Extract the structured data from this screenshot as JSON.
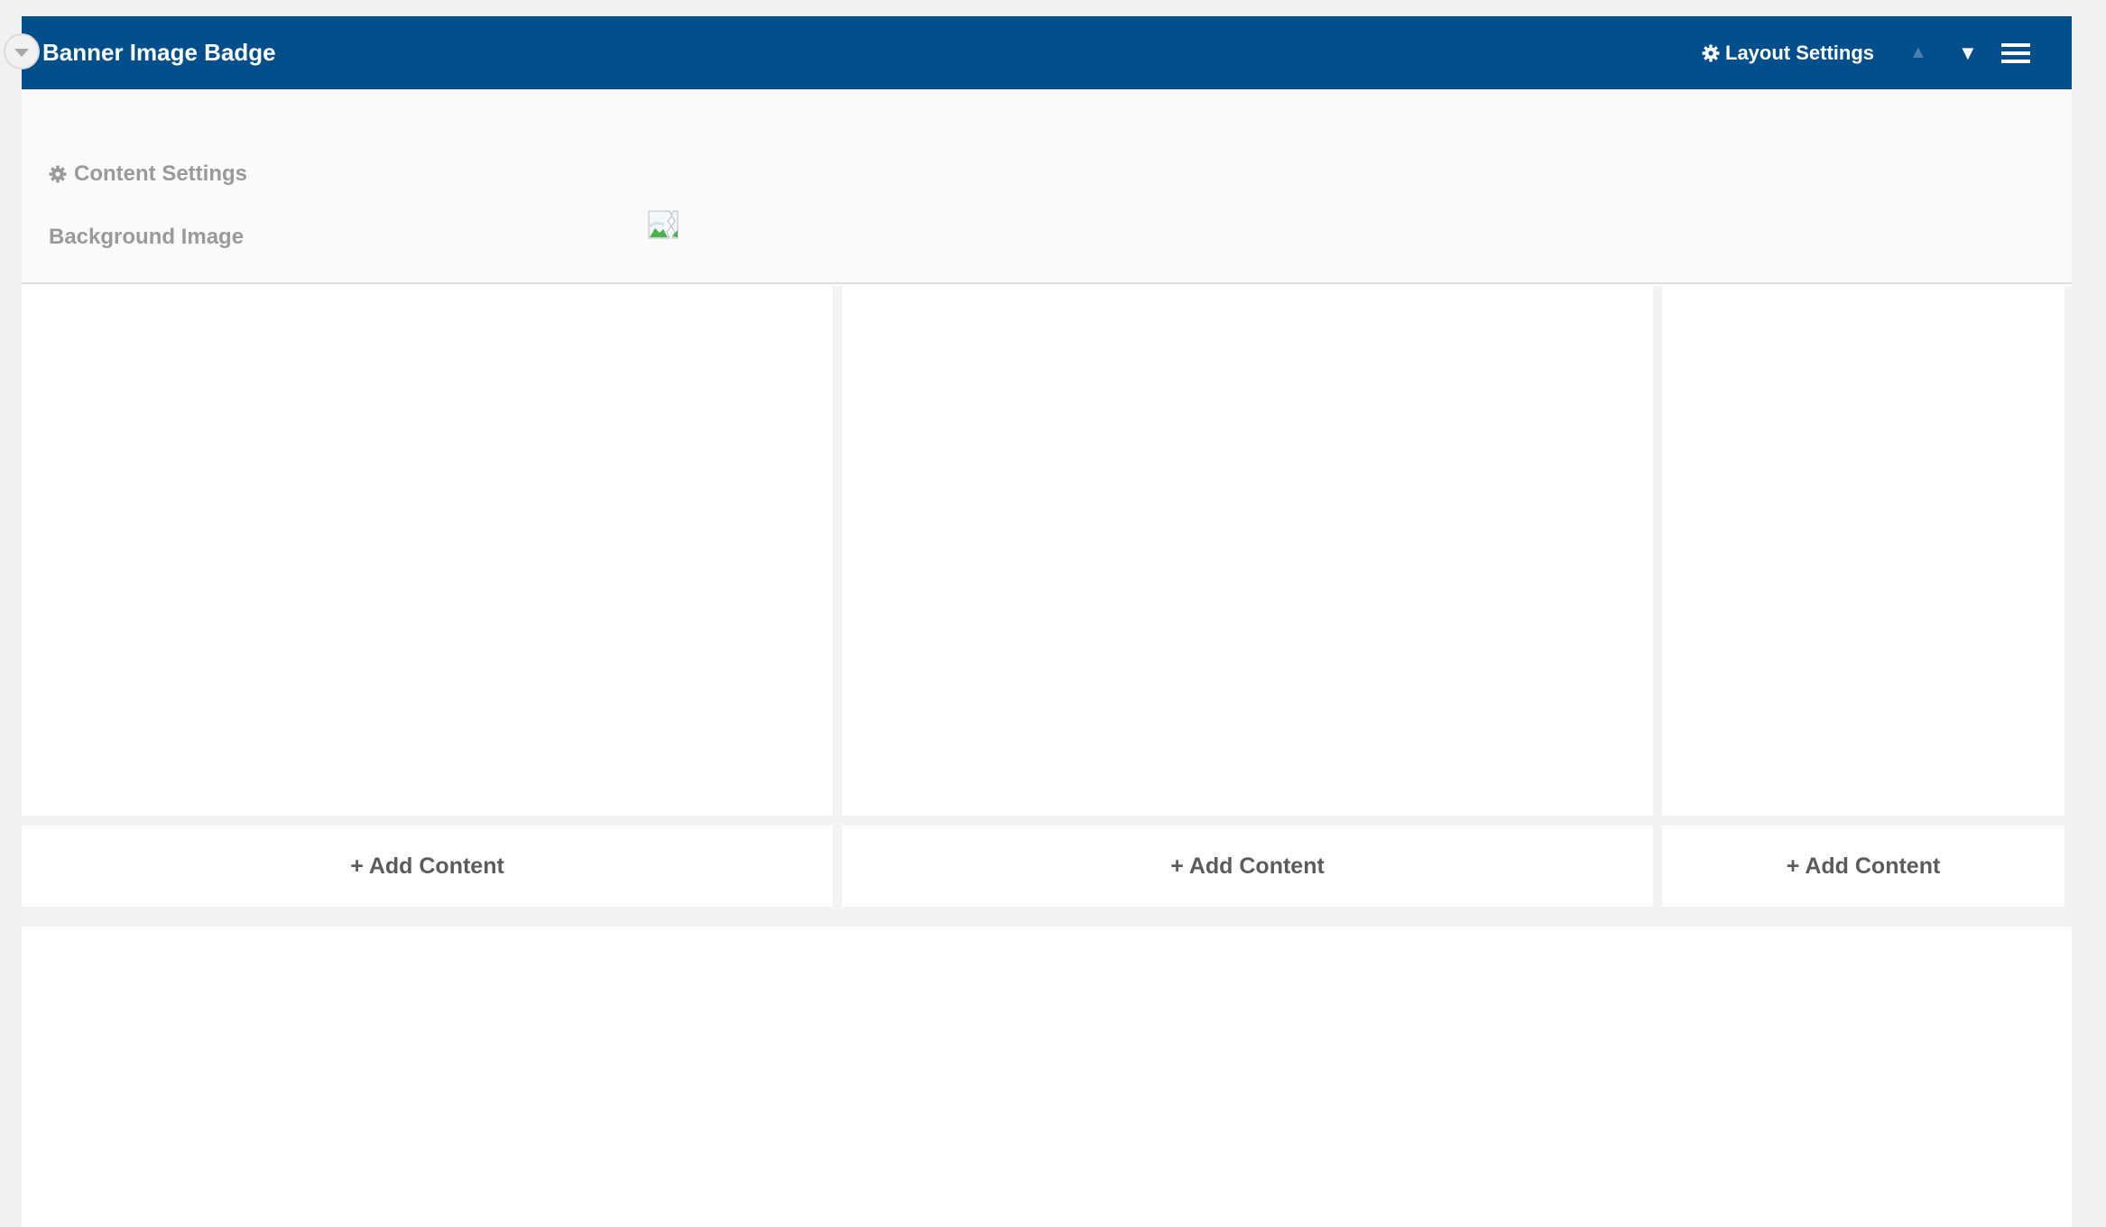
{
  "header": {
    "title": "Banner Image Badge",
    "layout_settings_label": "Layout Settings",
    "move_up_glyph": "▲",
    "move_down_glyph": "▼",
    "background_color": "#004f8b"
  },
  "settings": {
    "content_settings_label": "Content Settings",
    "background_image_label": "Background Image"
  },
  "columns": [
    {
      "add_content_label": "+ Add Content"
    },
    {
      "add_content_label": "+ Add Content"
    },
    {
      "add_content_label": "+ Add Content"
    }
  ],
  "icons": {
    "collapse": "chevron-down-icon",
    "gear": "gear-icon",
    "menu": "hamburger-menu-icon",
    "image": "broken-image-icon"
  }
}
